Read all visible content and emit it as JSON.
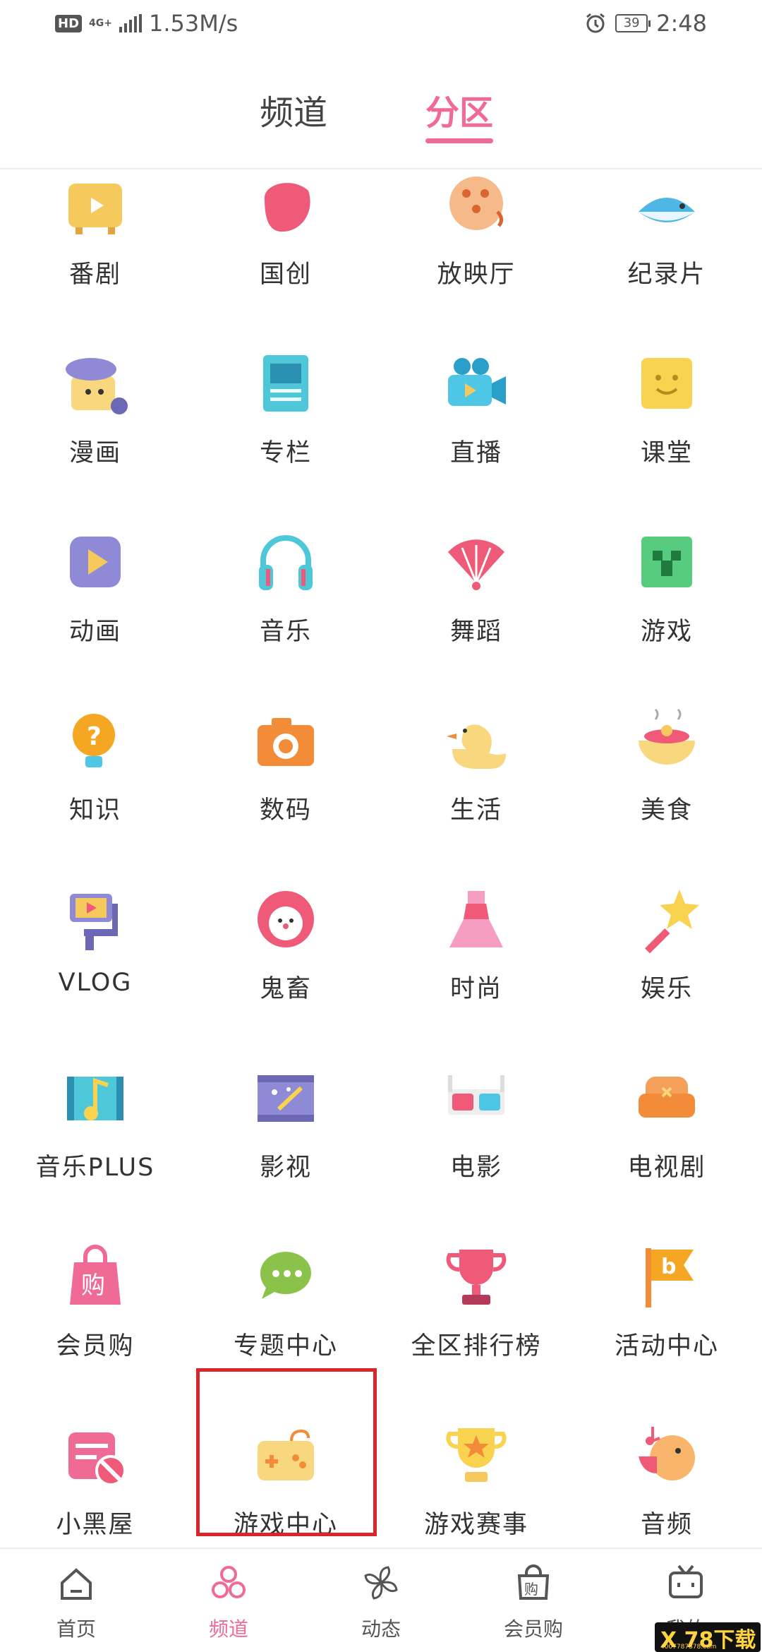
{
  "status_bar": {
    "hd": "HD",
    "network": "4G+",
    "speed": "1.53M/s",
    "battery": "39",
    "time": "2:48"
  },
  "top_tabs": [
    {
      "label": "频道",
      "active": false
    },
    {
      "label": "分区",
      "active": true
    }
  ],
  "accent_color": "#ef6b96",
  "highlight_color": "#d9262c",
  "zones": [
    {
      "label": "番剧",
      "icon": "tv-icon",
      "row": 0,
      "col": 0
    },
    {
      "label": "国创",
      "icon": "guochuang-icon",
      "row": 0,
      "col": 1
    },
    {
      "label": "放映厅",
      "icon": "popcorn-icon",
      "row": 0,
      "col": 2
    },
    {
      "label": "纪录片",
      "icon": "whale-icon",
      "row": 0,
      "col": 3
    },
    {
      "label": "漫画",
      "icon": "comic-icon",
      "row": 1,
      "col": 0
    },
    {
      "label": "专栏",
      "icon": "column-article-icon",
      "row": 1,
      "col": 1
    },
    {
      "label": "直播",
      "icon": "video-camera-icon",
      "row": 1,
      "col": 2
    },
    {
      "label": "课堂",
      "icon": "classroom-icon",
      "row": 1,
      "col": 3
    },
    {
      "label": "动画",
      "icon": "animation-play-icon",
      "row": 2,
      "col": 0
    },
    {
      "label": "音乐",
      "icon": "headphones-icon",
      "row": 2,
      "col": 1
    },
    {
      "label": "舞蹈",
      "icon": "fan-icon",
      "row": 2,
      "col": 2
    },
    {
      "label": "游戏",
      "icon": "creeper-icon",
      "row": 2,
      "col": 3
    },
    {
      "label": "知识",
      "icon": "lightbulb-question-icon",
      "row": 3,
      "col": 0
    },
    {
      "label": "数码",
      "icon": "camera-icon",
      "row": 3,
      "col": 1
    },
    {
      "label": "生活",
      "icon": "duck-icon",
      "row": 3,
      "col": 2
    },
    {
      "label": "美食",
      "icon": "food-bowl-icon",
      "row": 3,
      "col": 3
    },
    {
      "label": "VLOG",
      "icon": "vlog-stabilizer-icon",
      "row": 4,
      "col": 0
    },
    {
      "label": "鬼畜",
      "icon": "clown-icon",
      "row": 4,
      "col": 1
    },
    {
      "label": "时尚",
      "icon": "dress-icon",
      "row": 4,
      "col": 2
    },
    {
      "label": "娱乐",
      "icon": "star-wand-icon",
      "row": 4,
      "col": 3
    },
    {
      "label": "音乐PLUS",
      "icon": "music-film-icon",
      "row": 5,
      "col": 0
    },
    {
      "label": "影视",
      "icon": "film-magic-icon",
      "row": 5,
      "col": 1
    },
    {
      "label": "电影",
      "icon": "3d-glasses-icon",
      "row": 5,
      "col": 2
    },
    {
      "label": "电视剧",
      "icon": "sofa-icon",
      "row": 5,
      "col": 3
    },
    {
      "label": "会员购",
      "icon": "shopping-bag-icon",
      "row": 6,
      "col": 0
    },
    {
      "label": "专题中心",
      "icon": "chat-bubble-icon",
      "row": 6,
      "col": 1
    },
    {
      "label": "全区排行榜",
      "icon": "trophy-icon",
      "row": 6,
      "col": 2
    },
    {
      "label": "活动中心",
      "icon": "flag-icon",
      "row": 6,
      "col": 3
    },
    {
      "label": "小黑屋",
      "icon": "banned-icon",
      "row": 7,
      "col": 0
    },
    {
      "label": "游戏中心",
      "icon": "gamepad-icon",
      "row": 7,
      "col": 1,
      "highlighted": true
    },
    {
      "label": "游戏赛事",
      "icon": "star-cup-icon",
      "row": 7,
      "col": 2
    },
    {
      "label": "音频",
      "icon": "singing-bird-icon",
      "row": 7,
      "col": 3
    }
  ],
  "bottom_nav": [
    {
      "label": "首页",
      "icon": "home-icon",
      "active": false
    },
    {
      "label": "频道",
      "icon": "channel-circles-icon",
      "active": true
    },
    {
      "label": "动态",
      "icon": "pinwheel-icon",
      "active": false
    },
    {
      "label": "会员购",
      "icon": "shop-bag-icon",
      "active": false
    },
    {
      "label": "我的",
      "icon": "tv-face-icon",
      "active": false
    }
  ],
  "watermark": {
    "title": "X 78下载",
    "url": "4007787878.com"
  }
}
